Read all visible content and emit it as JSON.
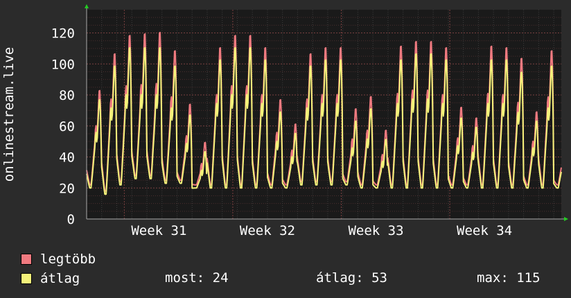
{
  "chart_data": {
    "type": "line",
    "title": "",
    "xlabel": "",
    "ylabel": "onlinestream.live",
    "ylim": [
      0,
      135
    ],
    "yticks": [
      0,
      20,
      40,
      60,
      80,
      100,
      120
    ],
    "x_range_days": [
      0,
      31.5
    ],
    "xticks": [
      {
        "label": "Week 31",
        "day": 4.8
      },
      {
        "label": "Week 32",
        "day": 12.0
      },
      {
        "label": "Week 33",
        "day": 19.2
      },
      {
        "label": "Week 34",
        "day": 26.4
      }
    ],
    "grid": true,
    "series": [
      {
        "name": "legtöbb",
        "color": "#f07a80",
        "daily_peaks": [
          84,
          108,
          120,
          121,
          122,
          110,
          75,
          50,
          112,
          120,
          120,
          112,
          78,
          62,
          108,
          112,
          112,
          72,
          80,
          58,
          113,
          116,
          116,
          112,
          73,
          66,
          113,
          112,
          105,
          70,
          110,
          60
        ],
        "daily_mins": [
          22,
          18,
          24,
          28,
          28,
          25,
          25,
          22,
          22,
          22,
          22,
          22,
          22,
          22,
          24,
          24,
          24,
          24,
          22,
          22,
          22,
          22,
          22,
          22,
          22,
          22,
          22,
          22,
          22,
          22,
          22,
          22
        ]
      },
      {
        "name": "átlag",
        "color": "#f4f27a",
        "daily_peaks": [
          78,
          100,
          112,
          112,
          112,
          100,
          68,
          44,
          104,
          112,
          112,
          104,
          70,
          56,
          100,
          104,
          104,
          64,
          72,
          52,
          104,
          108,
          108,
          104,
          66,
          60,
          104,
          104,
          96,
          64,
          100,
          55
        ],
        "daily_mins": [
          20,
          16,
          22,
          26,
          26,
          23,
          23,
          20,
          20,
          20,
          20,
          20,
          20,
          20,
          22,
          22,
          22,
          22,
          20,
          20,
          20,
          20,
          20,
          20,
          20,
          20,
          20,
          20,
          20,
          20,
          20,
          20
        ]
      }
    ]
  },
  "legend": {
    "items": [
      {
        "label": "legtöbb",
        "color": "#f07a80"
      },
      {
        "label": "átlag",
        "color": "#f4f27a"
      }
    ]
  },
  "stats": {
    "now": "most: 24",
    "avg": "átlag: 53",
    "max": "max: 115"
  }
}
